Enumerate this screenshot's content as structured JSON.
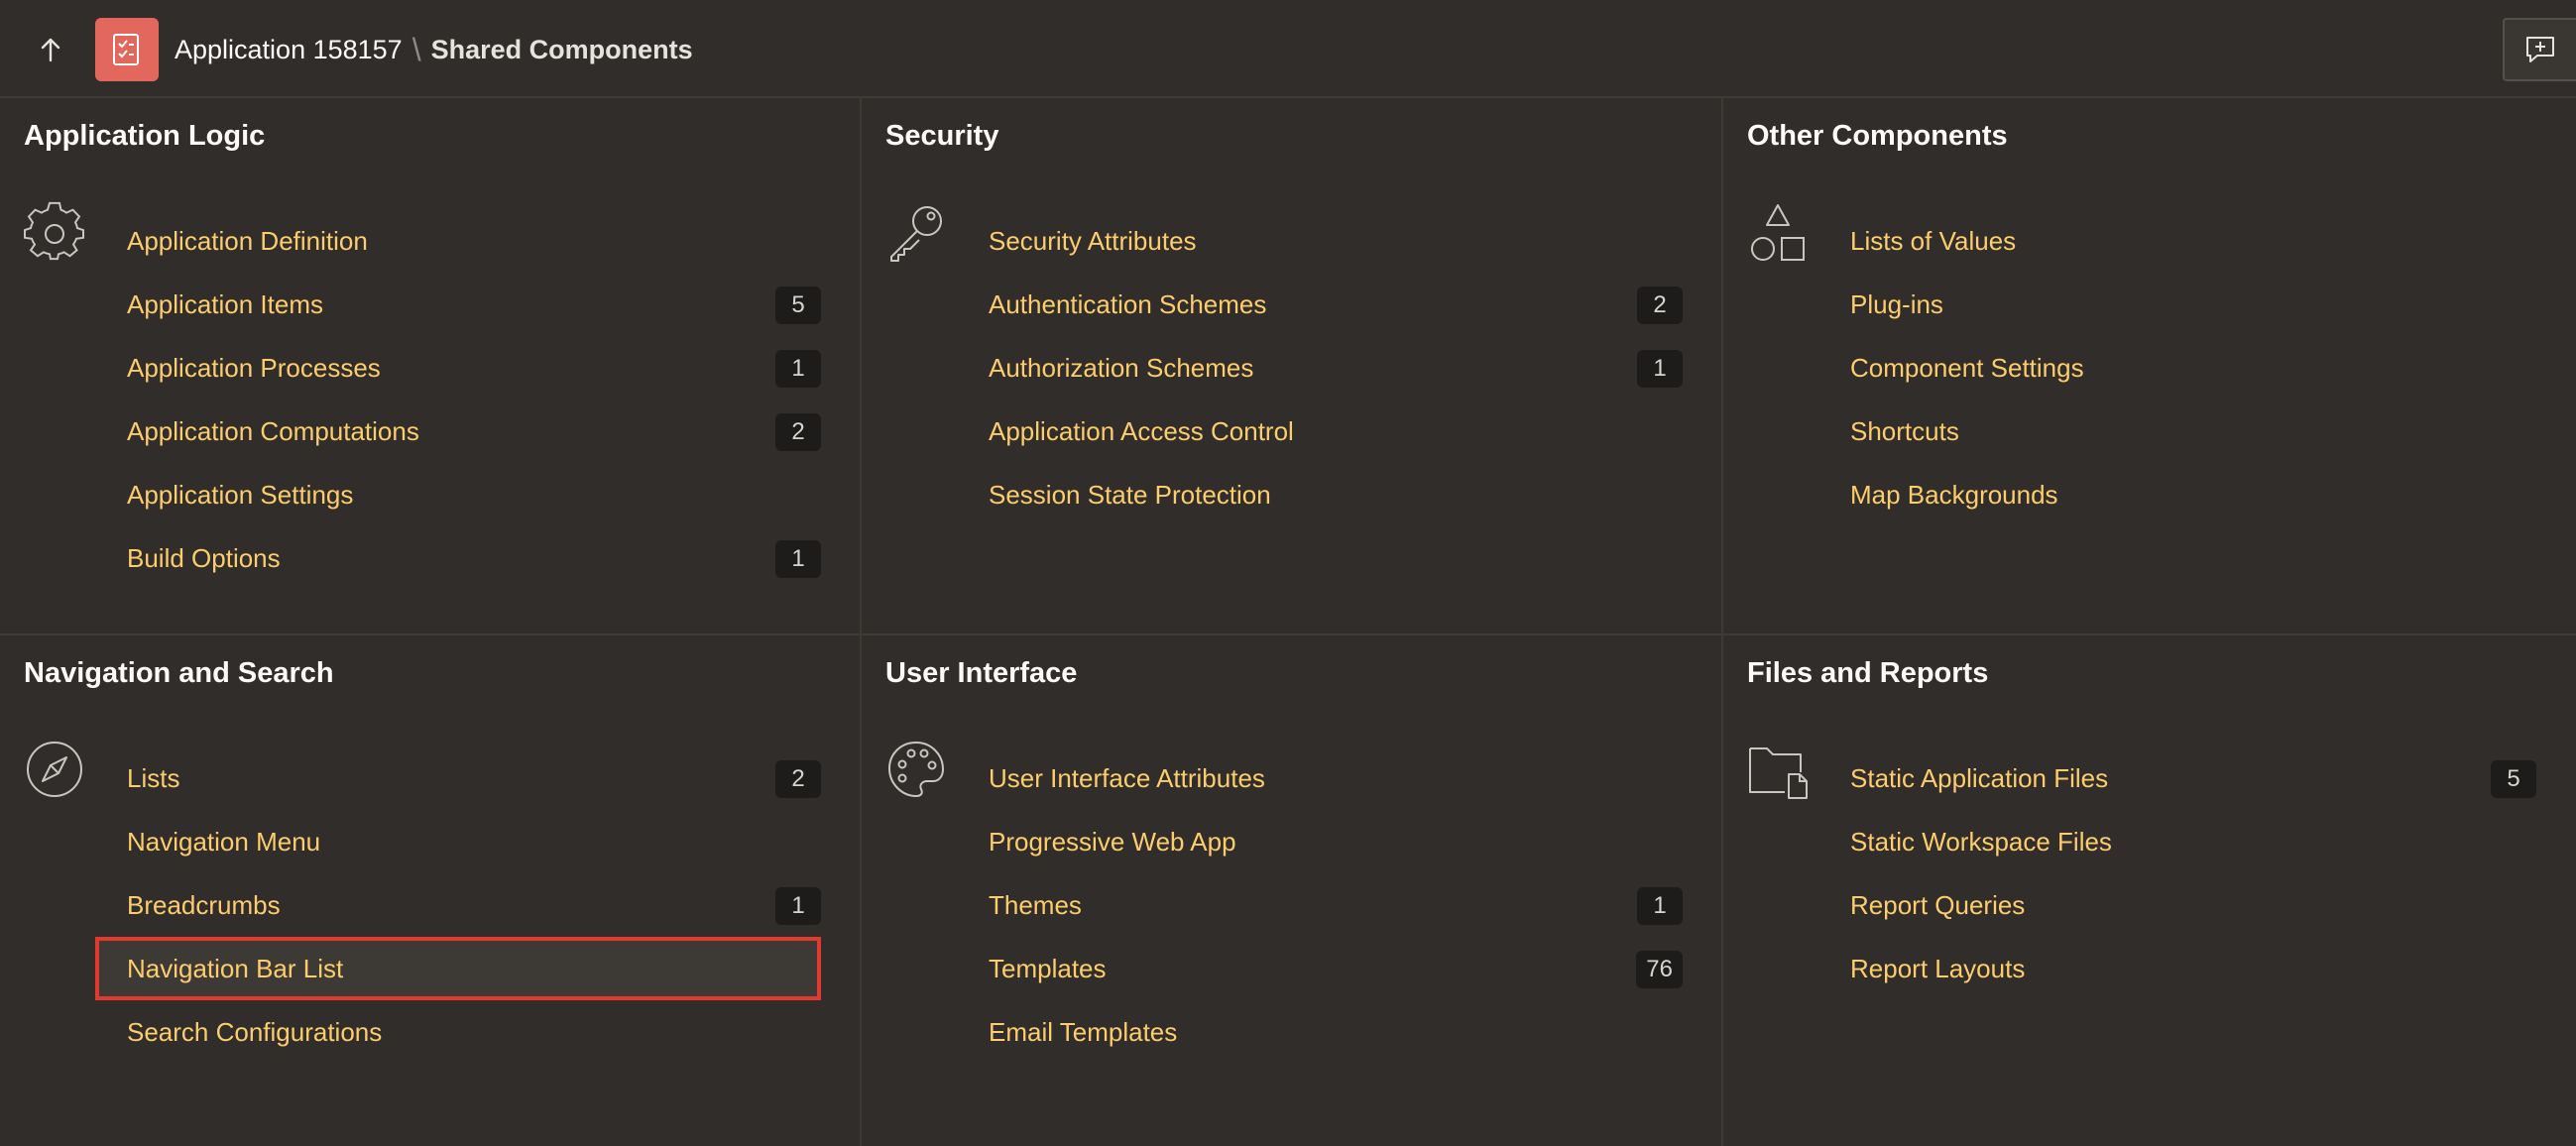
{
  "header": {
    "app_name": "Application 158157",
    "separator": "\\",
    "current_page": "Shared Components"
  },
  "panels": {
    "app_logic": {
      "title": "Application Logic",
      "icon": "gear-icon",
      "items": [
        {
          "label": "Application Definition",
          "count": ""
        },
        {
          "label": "Application Items",
          "count": "5"
        },
        {
          "label": "Application Processes",
          "count": "1"
        },
        {
          "label": "Application Computations",
          "count": "2"
        },
        {
          "label": "Application Settings",
          "count": ""
        },
        {
          "label": "Build Options",
          "count": "1"
        }
      ]
    },
    "security": {
      "title": "Security",
      "icon": "key-icon",
      "items": [
        {
          "label": "Security Attributes",
          "count": ""
        },
        {
          "label": "Authentication Schemes",
          "count": "2"
        },
        {
          "label": "Authorization Schemes",
          "count": "1"
        },
        {
          "label": "Application Access Control",
          "count": ""
        },
        {
          "label": "Session State Protection",
          "count": ""
        }
      ]
    },
    "other": {
      "title": "Other Components",
      "icon": "shapes-icon",
      "items": [
        {
          "label": "Lists of Values",
          "count": ""
        },
        {
          "label": "Plug-ins",
          "count": ""
        },
        {
          "label": "Component Settings",
          "count": ""
        },
        {
          "label": "Shortcuts",
          "count": ""
        },
        {
          "label": "Map Backgrounds",
          "count": ""
        }
      ]
    },
    "nav": {
      "title": "Navigation and Search",
      "icon": "compass-icon",
      "items": [
        {
          "label": "Lists",
          "count": "2"
        },
        {
          "label": "Navigation Menu",
          "count": ""
        },
        {
          "label": "Breadcrumbs",
          "count": "1"
        },
        {
          "label": "Navigation Bar List",
          "count": ""
        },
        {
          "label": "Search Configurations",
          "count": ""
        }
      ]
    },
    "ui": {
      "title": "User Interface",
      "icon": "palette-icon",
      "items": [
        {
          "label": "User Interface Attributes",
          "count": ""
        },
        {
          "label": "Progressive Web App",
          "count": ""
        },
        {
          "label": "Themes",
          "count": "1"
        },
        {
          "label": "Templates",
          "count": "76"
        },
        {
          "label": "Email Templates",
          "count": ""
        }
      ]
    },
    "files": {
      "title": "Files and Reports",
      "icon": "folder-file-icon",
      "items": [
        {
          "label": "Static Application Files",
          "count": "5"
        },
        {
          "label": "Static Workspace Files",
          "count": ""
        },
        {
          "label": "Report Queries",
          "count": ""
        },
        {
          "label": "Report Layouts",
          "count": ""
        }
      ]
    }
  },
  "colors": {
    "background": "#312d2a",
    "link": "#fccd6e",
    "app_icon": "#e2675c",
    "highlight_border": "#e03a2e"
  }
}
